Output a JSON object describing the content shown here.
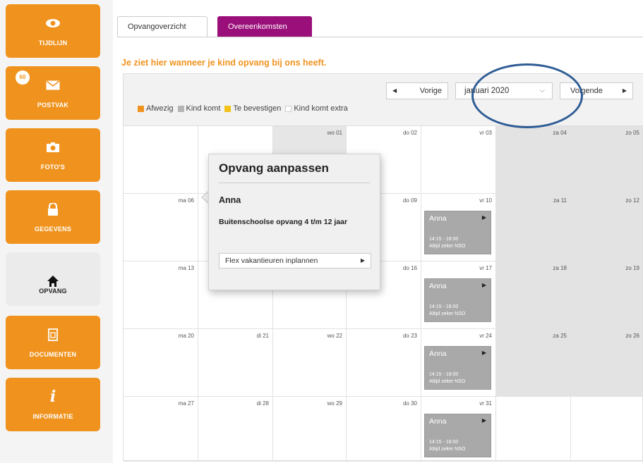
{
  "sidebar": {
    "items": [
      {
        "label": "TIJDLIJN",
        "icon": "eye-icon"
      },
      {
        "label": "POSTVAK",
        "icon": "mail-icon",
        "badge": "60"
      },
      {
        "label": "FOTO'S",
        "icon": "camera-icon"
      },
      {
        "label": "GEGEVENS",
        "icon": "lock-icon"
      },
      {
        "label": "OPVANG",
        "icon": "home-icon",
        "active": true
      },
      {
        "label": "DOCUMENTEN",
        "icon": "document-icon"
      },
      {
        "label": "INFORMATIE",
        "icon": "info-icon"
      }
    ]
  },
  "tabs": {
    "overview": "Opvangoverzicht",
    "agreements": "Overeenkomsten"
  },
  "intro": "Je ziet hier wanneer je kind opvang bij ons heeft.",
  "calendar": {
    "prev": "Vorige",
    "next": "Volgende",
    "month": "januari 2020",
    "legend": [
      {
        "label": "Afwezig",
        "color": "#f0931e"
      },
      {
        "label": "Kind komt",
        "color": "#b5b5b5"
      },
      {
        "label": "Te bevestigen",
        "color": "#f2c21a"
      },
      {
        "label": "Kind komt extra",
        "color": "#ffffff"
      }
    ],
    "rows": [
      [
        "",
        "",
        "wo 01",
        "do 02",
        "vr 03",
        "za 04",
        "zo 05"
      ],
      [
        "ma 06",
        "",
        "",
        "do 09",
        "vr 10",
        "za 11",
        "zo 12"
      ],
      [
        "ma 13",
        "",
        "",
        "do 16",
        "vr 17",
        "za 18",
        "zo 19"
      ],
      [
        "ma 20",
        "di 21",
        "wo 22",
        "do 23",
        "vr 24",
        "za 25",
        "zo 26"
      ],
      [
        "ma 27",
        "di 28",
        "wo 29",
        "do 30",
        "vr 31",
        "",
        ""
      ]
    ],
    "event": {
      "name": "Anna",
      "time": "14:15 - 18:00",
      "type": "Altijd zeker NSO"
    }
  },
  "popup": {
    "title": "Opvang aanpassen",
    "name": "Anna",
    "desc": "Buitenschoolse opvang 4 t/m 12 jaar",
    "button": "Flex vakantieuren inplannen"
  },
  "colors": {
    "orange": "#f0931e",
    "purple": "#9a0f7a",
    "annotation": "#2f5d95"
  }
}
